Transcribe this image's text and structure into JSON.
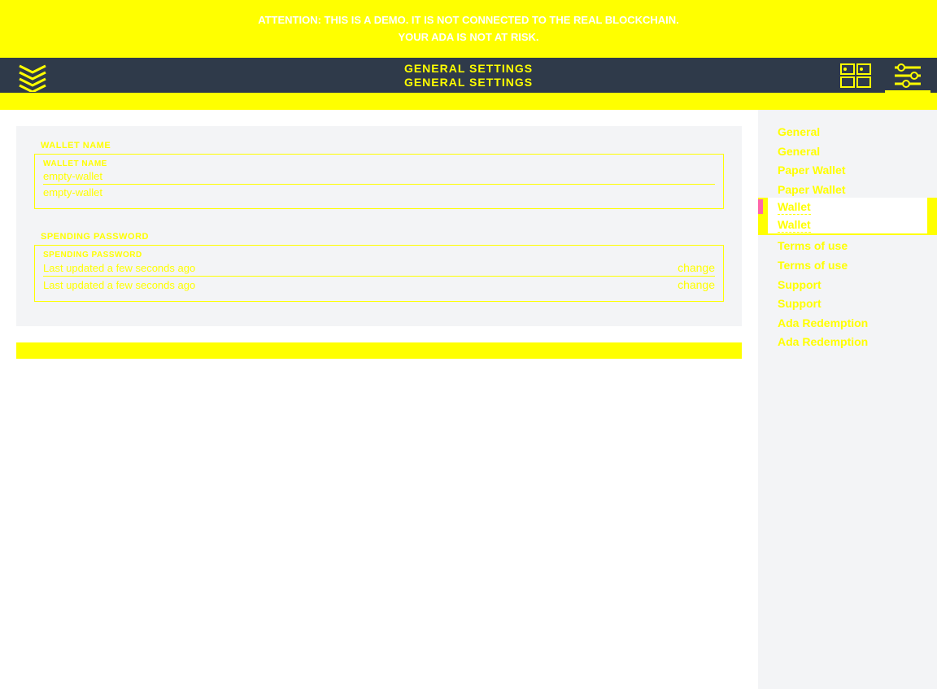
{
  "banner": {
    "line1": "ATTENTION: THIS IS A DEMO. IT IS NOT CONNECTED TO THE REAL BLOCKCHAIN.",
    "line2": "YOUR ADA IS NOT AT RISK."
  },
  "header": {
    "title1": "GENERAL SETTINGS",
    "title2": "GENERAL SETTINGS"
  },
  "wallet_name_section": {
    "outer_label": "WALLET NAME",
    "inner_label": "WALLET NAME",
    "value1": "empty-wallet",
    "value2": "empty-wallet"
  },
  "spending_password_section": {
    "outer_label": "SPENDING PASSWORD",
    "inner_label": "SPENDING PASSWORD",
    "status1": "Last updated a few seconds ago",
    "action1": "change",
    "status2": "Last updated a few seconds ago",
    "action2": "change"
  },
  "sidebar": {
    "items": [
      "General",
      "General",
      "Paper Wallet",
      "Paper Wallet",
      "Wallet",
      "Wallet",
      "Terms of use",
      "Terms of use",
      "Support",
      "Support",
      "Ada Redemption",
      "Ada Redemption"
    ]
  }
}
